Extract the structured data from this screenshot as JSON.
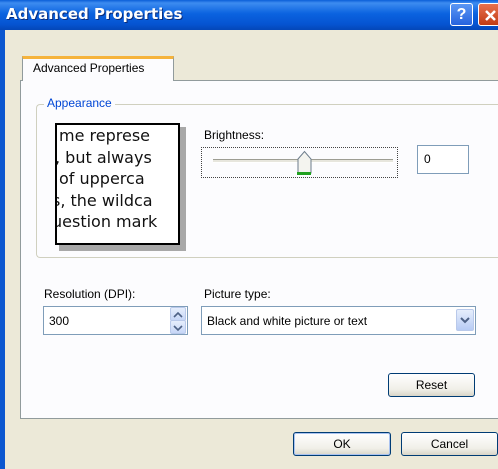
{
  "window": {
    "title": "Advanced Properties",
    "help_label": "?"
  },
  "tab": {
    "label": "Advanced Properties"
  },
  "appearance": {
    "group_label": "Appearance",
    "preview_lines": [
      "me represe",
      ", but always",
      " of upperca",
      "s, the wildca",
      "uestion mark"
    ],
    "brightness_label": "Brightness:",
    "brightness_value": "0",
    "brightness_level": 0.52
  },
  "resolution": {
    "label": "Resolution (DPI):",
    "value": "300"
  },
  "picture_type": {
    "label": "Picture type:",
    "selected": "Black and white picture or text"
  },
  "buttons": {
    "reset": "Reset",
    "ok": "OK",
    "cancel": "Cancel"
  },
  "colors": {
    "titlebar": "#0554d2",
    "group_label": "#0046d5",
    "tab_highlight": "#f5b33c",
    "slider_accent": "#21a121"
  }
}
